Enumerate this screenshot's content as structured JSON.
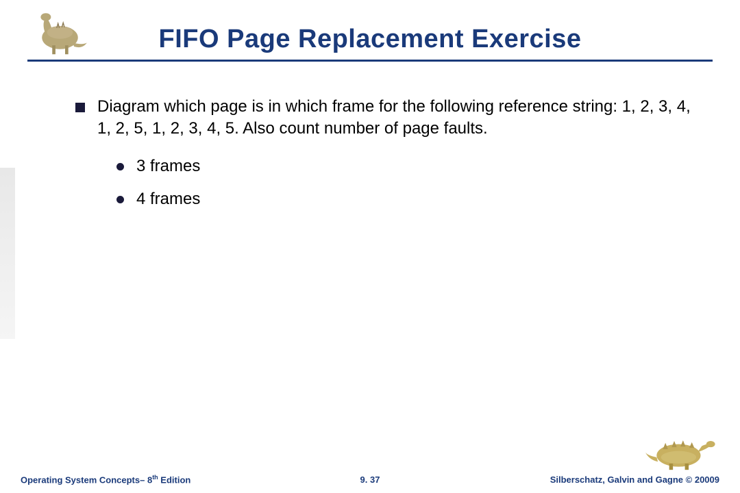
{
  "title": "FIFO Page Replacement Exercise",
  "main_bullet": "Diagram which page is in which frame for the following reference string: 1, 2, 3, 4, 1, 2, 5, 1, 2, 3, 4, 5.  Also count number of page faults.",
  "sub_bullets": [
    "3 frames",
    "4 frames"
  ],
  "footer": {
    "left_book": "Operating System Concepts– ",
    "left_edition_num": "8",
    "left_edition_suffix": "th",
    "left_edition_word": " Edition",
    "page": "9. 37",
    "right": "Silberschatz, Galvin and Gagne © 20009"
  }
}
